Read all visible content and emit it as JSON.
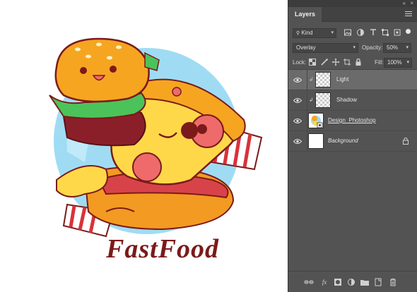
{
  "artwork": {
    "title_text": "FastFood",
    "bg_circle_color": "#8fd7f2",
    "accent_color": "#7b1a1a"
  },
  "panel": {
    "collapse_icon": "double-chevron",
    "close_icon": "close",
    "tab_label": "Layers",
    "menu_icon": "panel-menu",
    "filter": {
      "kind_label": "Kind",
      "icons": [
        "image-filter-icon",
        "adjustment-filter-icon",
        "type-filter-icon",
        "shape-filter-icon",
        "smart-object-filter-icon"
      ]
    },
    "blend": {
      "mode": "Overlay",
      "opacity_label": "Opacity:",
      "opacity_value": "50%"
    },
    "lock": {
      "label": "Lock:",
      "icons": [
        "lock-transparent-icon",
        "lock-image-icon",
        "lock-position-icon",
        "lock-artboard-icon",
        "lock-all-icon"
      ],
      "fill_label": "Fill:",
      "fill_value": "100%"
    },
    "layers": [
      {
        "name": "Light",
        "selected": true,
        "clipped": true,
        "thumb": "transparent"
      },
      {
        "name": "Shadow",
        "selected": false,
        "clipped": true,
        "thumb": "transparent"
      },
      {
        "name": "Design_Photoshop",
        "selected": false,
        "clipped": false,
        "thumb": "smart-object"
      },
      {
        "name": "Background",
        "selected": false,
        "clipped": false,
        "thumb": "white",
        "locked": true
      }
    ],
    "footer_icons": [
      "link-layers-icon",
      "fx-icon",
      "add-mask-icon",
      "adjustment-layer-icon",
      "new-group-icon",
      "new-layer-icon",
      "trash-icon"
    ]
  },
  "colors": {
    "panel_bg": "#535353",
    "selected_row": "#6b6b6b",
    "bun": "#f6a521",
    "cheese": "#ffd84a",
    "pepperoni": "#ef6b6b",
    "lettuce": "#4cc35a"
  }
}
